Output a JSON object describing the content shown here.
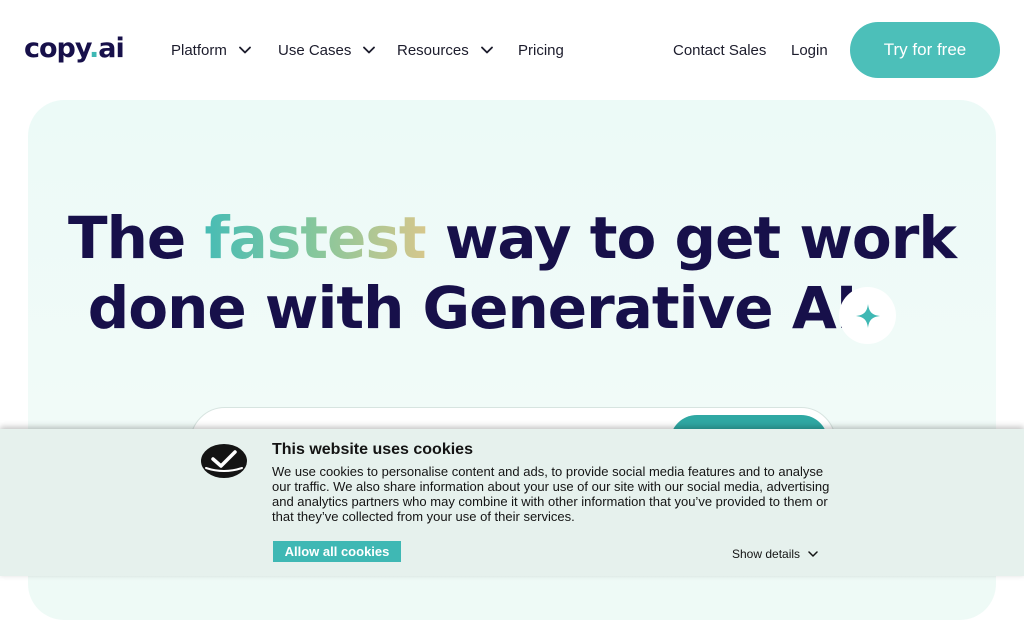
{
  "brand": {
    "logo_main": "copy",
    "logo_dot": ".",
    "logo_suffix": "ai",
    "accent": "#3fb8b4",
    "ink": "#17104a"
  },
  "nav": {
    "items": [
      {
        "label": "Platform",
        "has_dropdown": true
      },
      {
        "label": "Use Cases",
        "has_dropdown": true
      },
      {
        "label": "Resources",
        "has_dropdown": true
      },
      {
        "label": "Pricing",
        "has_dropdown": false
      }
    ],
    "contact_sales": "Contact Sales",
    "login": "Login",
    "cta": "Try for free"
  },
  "hero": {
    "headline_pre": "The ",
    "headline_highlight": "fastest",
    "headline_post_line1": " way to get work",
    "headline_line2": "done with Generative AI",
    "sparkle_icon": "sparkle-icon"
  },
  "cookie_banner": {
    "title": "This website uses cookies",
    "body": "We use cookies to personalise content and ads, to provide social media features and to analyse our traffic. We also share information about your use of our site with our social media, advertising and analytics partners who may combine it with other information that you’ve provided to them or that they’ve collected from your use of their services.",
    "allow_all": "Allow all cookies",
    "show_details": "Show details"
  }
}
